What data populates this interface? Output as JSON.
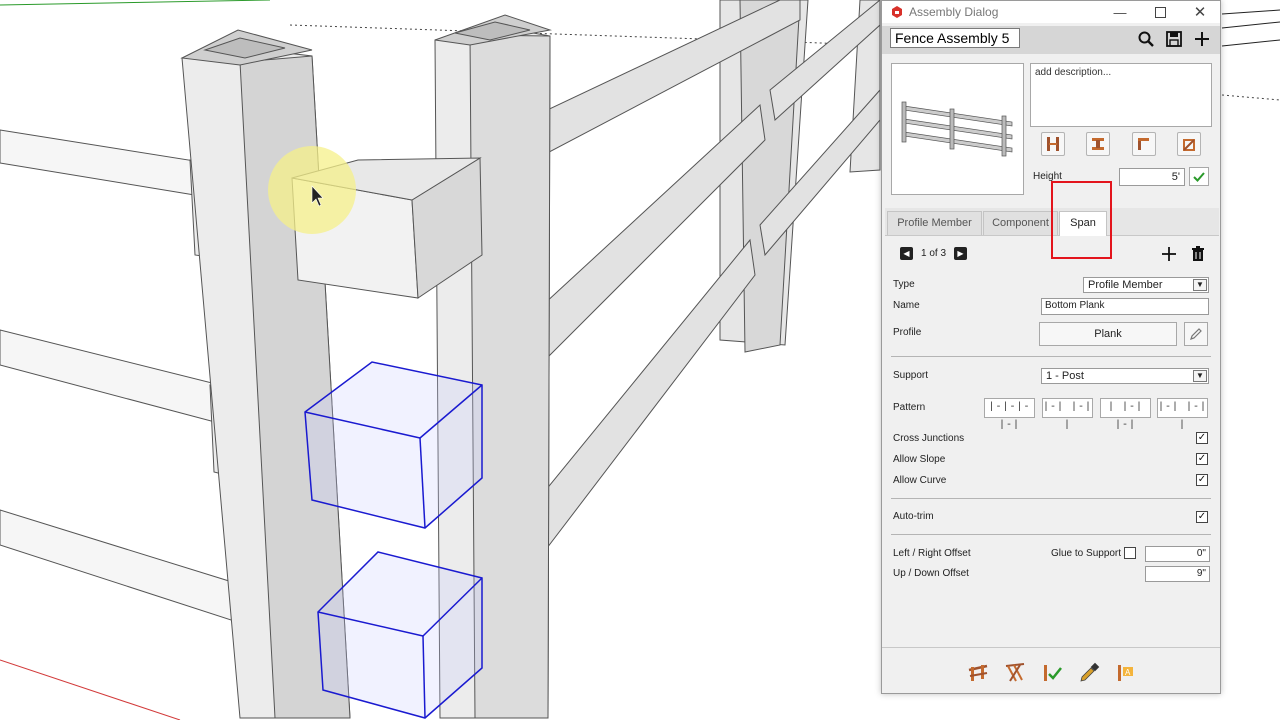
{
  "dialog": {
    "title": "Assembly Dialog",
    "assembly_name": "Fence Assembly 5",
    "description": "add description...",
    "height_label": "Height",
    "height_value": "5'",
    "tabs": [
      {
        "label": "Profile Member"
      },
      {
        "label": "Component"
      },
      {
        "label": "Span"
      }
    ],
    "pager": "1 of 3",
    "fields": {
      "type_label": "Type",
      "type_value": "Profile Member",
      "name_label": "Name",
      "name_value": "Bottom Plank",
      "profile_label": "Profile",
      "profile_value": "Plank",
      "support_label": "Support",
      "support_value": "1 - Post",
      "pattern_label": "Pattern",
      "patterns": [
        "|-|-|-|-|",
        "|-| |-| |",
        "| |-| |-|",
        "|-| |-| |"
      ],
      "cross_junctions_label": "Cross Junctions",
      "allow_slope_label": "Allow Slope",
      "allow_curve_label": "Allow Curve",
      "auto_trim_label": "Auto-trim",
      "left_right_offset_label": "Left / Right Offset",
      "glue_to_support_label": "Glue to Support",
      "left_right_offset_value": "0\"",
      "up_down_offset_label": "Up / Down Offset",
      "up_down_offset_value": "9\""
    },
    "checkboxes": {
      "cross_junctions": true,
      "allow_slope": true,
      "allow_curve": true,
      "auto_trim": true,
      "glue_to_support": false
    }
  },
  "colors": {
    "highlight_box": "#e3141c",
    "selection_blue": "#1a1ad0",
    "cursor_highlight": "#f5f08a"
  }
}
